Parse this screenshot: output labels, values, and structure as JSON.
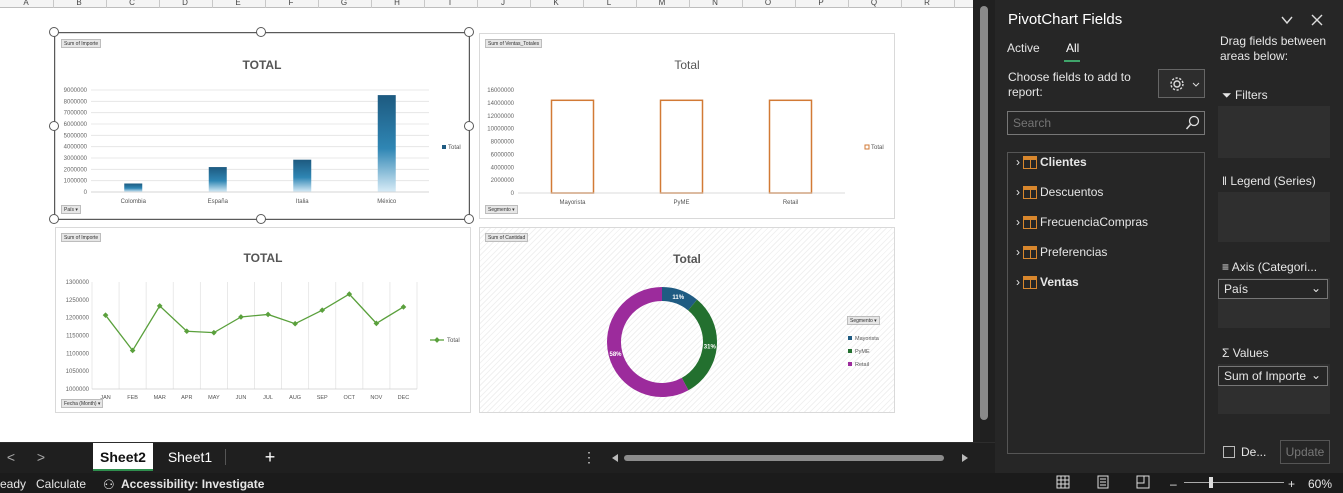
{
  "columns": [
    "A",
    "B",
    "C",
    "D",
    "E",
    "F",
    "G",
    "H",
    "I",
    "J",
    "K",
    "L",
    "M",
    "N",
    "O",
    "P",
    "Q",
    "R"
  ],
  "charts": {
    "country": {
      "field_button": "Sum of Importe",
      "axis_button": "País",
      "title": "TOTAL",
      "legend": "Total",
      "chart_data": {
        "type": "bar",
        "categories": [
          "Colombia",
          "España",
          "Italia",
          "México"
        ],
        "values": [
          750000,
          2200000,
          2850000,
          8550000
        ],
        "ylim": [
          0,
          9000000
        ],
        "yticks": [
          "9000000",
          "8000000",
          "7000000",
          "6000000",
          "5000000",
          "4000000",
          "3000000",
          "2000000",
          "1000000",
          "0"
        ],
        "legend": "Total"
      }
    },
    "segment_bar": {
      "field_button": "Sum of Ventas_Totales",
      "axis_button": "Segmento",
      "title": "Total",
      "legend": "Total",
      "chart_data": {
        "type": "bar",
        "categories": [
          "Mayorista",
          "PyME",
          "Retail"
        ],
        "values": [
          14400000,
          14400000,
          14400000
        ],
        "ylim": [
          0,
          16000000
        ],
        "yticks": [
          "16000000",
          "14000000",
          "12000000",
          "10000000",
          "8000000",
          "6000000",
          "4000000",
          "2000000",
          "0"
        ],
        "legend": "Total"
      }
    },
    "monthly": {
      "field_button": "Sum of Importe",
      "axis_button": "Fecha (Month)",
      "title": "TOTAL",
      "legend": "Total",
      "chart_data": {
        "type": "line",
        "categories": [
          "JAN",
          "FEB",
          "MAR",
          "APR",
          "MAY",
          "JUN",
          "JUL",
          "AUG",
          "SEP",
          "OCT",
          "NOV",
          "DEC"
        ],
        "values": [
          1207000,
          1108000,
          1233000,
          1162000,
          1158000,
          1202000,
          1209000,
          1183000,
          1221000,
          1266000,
          1184000,
          1230000
        ],
        "ylim": [
          1000000,
          1300000
        ],
        "yticks": [
          "1300000",
          "1250000",
          "1200000",
          "1150000",
          "1100000",
          "1050000",
          "1000000"
        ],
        "legend": "Total"
      }
    },
    "donut": {
      "field_button": "Sum of Cantidad",
      "legend_button": "Segmento",
      "title": "Total",
      "chart_data": {
        "type": "pie",
        "labels": [
          "Mayorista",
          "PyME",
          "Retail"
        ],
        "values": [
          11,
          31,
          58
        ],
        "data_labels": [
          "11%",
          "31%",
          "58%"
        ],
        "colors": [
          "#1f5b82",
          "#23702f",
          "#9c2b9c"
        ]
      }
    }
  },
  "tabs": {
    "sheet2": "Sheet2",
    "sheet1": "Sheet1",
    "add": "+",
    "prev": "<",
    "next": ">"
  },
  "status": {
    "ready": "eady",
    "calculate": "Calculate",
    "accessibility": "Accessibility: Investigate",
    "zoom": "60%",
    "minus": "–",
    "plus": "+"
  },
  "pane": {
    "title": "PivotChart Fields",
    "tab_active": "Active",
    "tab_all": "All",
    "choose": "Choose fields to add to report:",
    "search_placeholder": "Search",
    "fields": [
      "Clientes",
      "Descuentos",
      "FrecuenciaCompras",
      "Preferencias",
      "Ventas"
    ],
    "drag_hint": "Drag fields between areas below:",
    "filters": "Filters",
    "legend_series": "Legend (Series)",
    "axis": "Axis (Categori...",
    "axis_value": "País",
    "values": "Values",
    "values_value": "Sum of Importe",
    "defer": "De...",
    "update": "Update"
  }
}
